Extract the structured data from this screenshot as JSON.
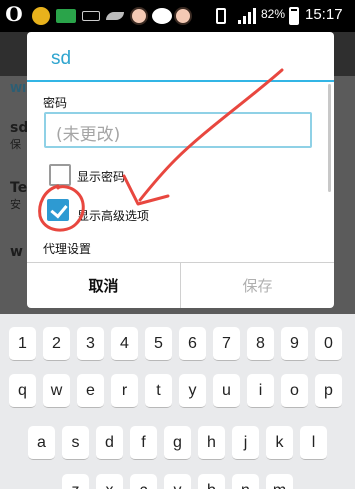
{
  "status_bar": {
    "battery_percent": "82%",
    "time": "15:17",
    "icons": [
      "opera-icon",
      "qq-icon",
      "app-88-icon",
      "keyboard-icon",
      "leaf-icon",
      "avatar-icon",
      "wechat-icon",
      "avatar-icon",
      "phone-icon",
      "signal-icon",
      "battery-icon"
    ]
  },
  "background": {
    "section_label": "WI",
    "rows": [
      {
        "title": "sd",
        "subtitle": "保"
      },
      {
        "title": "Te",
        "subtitle": "安"
      },
      {
        "title": "w",
        "subtitle": ""
      }
    ]
  },
  "dialog": {
    "title": "sd",
    "password_label": "密码",
    "password_placeholder": "(未更改)",
    "show_password_label": "显示密码",
    "show_password_checked": false,
    "advanced_label": "显示高级选项",
    "advanced_checked": true,
    "proxy_label": "代理设置",
    "cancel_label": "取消",
    "save_label": "保存"
  },
  "annotation": {
    "color": "#e8473f"
  },
  "keyboard": {
    "rows": [
      [
        "1",
        "2",
        "3",
        "4",
        "5",
        "6",
        "7",
        "8",
        "9",
        "0"
      ],
      [
        "q",
        "w",
        "e",
        "r",
        "t",
        "y",
        "u",
        "i",
        "o",
        "p"
      ],
      [
        "a",
        "s",
        "d",
        "f",
        "g",
        "h",
        "j",
        "k",
        "l"
      ],
      [
        "z",
        "x",
        "c",
        "v",
        "b",
        "n",
        "m"
      ]
    ]
  }
}
